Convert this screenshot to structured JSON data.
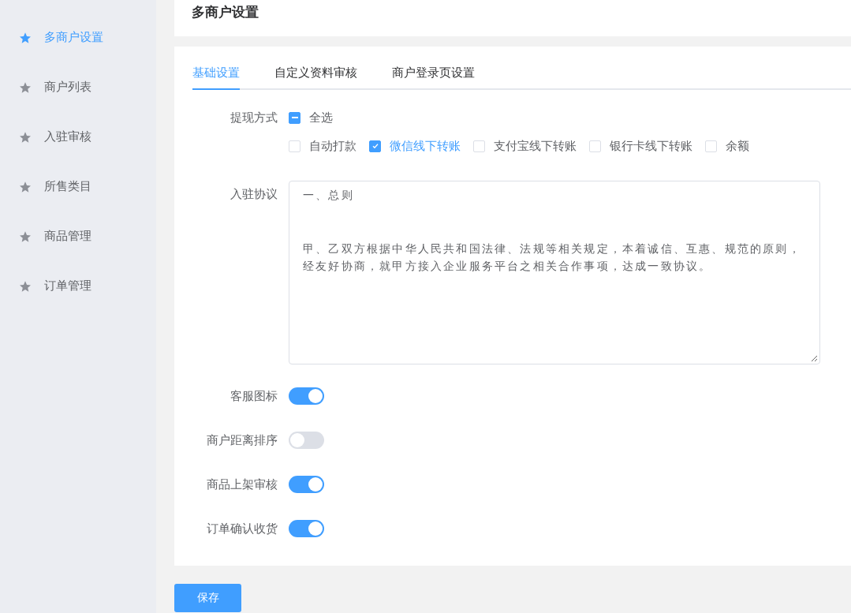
{
  "sidebar": {
    "items": [
      {
        "label": "多商户设置",
        "selected": true
      },
      {
        "label": "商户列表",
        "selected": false
      },
      {
        "label": "入驻审核",
        "selected": false
      },
      {
        "label": "所售类目",
        "selected": false
      },
      {
        "label": "商品管理",
        "selected": false
      },
      {
        "label": "订单管理",
        "selected": false
      }
    ]
  },
  "page_title": "多商户设置",
  "tabs": [
    {
      "label": "基础设置",
      "selected": true
    },
    {
      "label": "自定义资料审核",
      "selected": false
    },
    {
      "label": "商户登录页设置",
      "selected": false
    }
  ],
  "withdrawal": {
    "label": "提现方式",
    "select_all": {
      "label": "全选",
      "indeterminate": true
    },
    "options": [
      {
        "label": "自动打款",
        "checked": false
      },
      {
        "label": "微信线下转账",
        "checked": true
      },
      {
        "label": "支付宝线下转账",
        "checked": false
      },
      {
        "label": "银行卡线下转账",
        "checked": false
      },
      {
        "label": "余额",
        "checked": false
      }
    ]
  },
  "agreement": {
    "label": "入驻协议",
    "heading": "一、总则",
    "lines": [
      "甲、乙双方根据中华人民共和国法律、法规等相关规定，本着诚信、互惠、规范的原则，",
      "经友好协商，就甲方接入企业服务平台之相关合作事项，达成一致协议。"
    ]
  },
  "switches": [
    {
      "label": "客服图标",
      "on": true
    },
    {
      "label": "商户距离排序",
      "on": false
    },
    {
      "label": "商品上架审核",
      "on": true
    },
    {
      "label": "订单确认收货",
      "on": true
    }
  ],
  "save_button": "保存"
}
